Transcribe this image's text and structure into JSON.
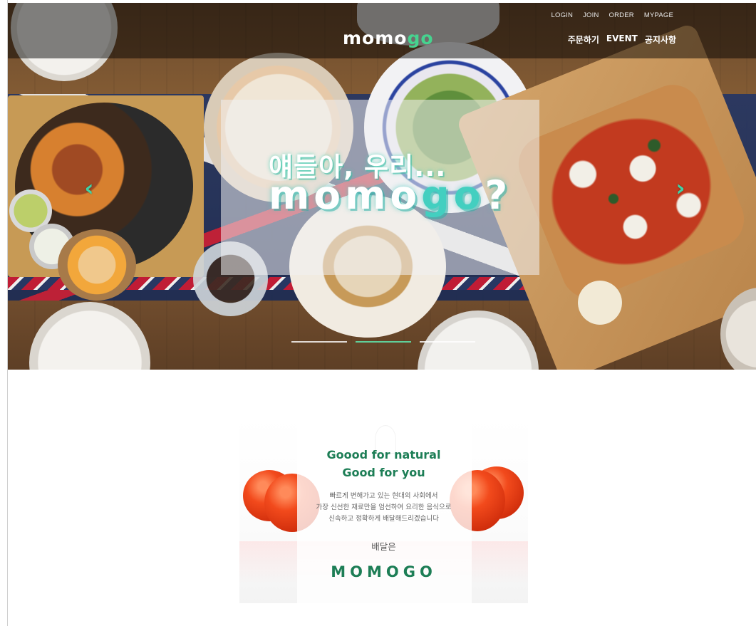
{
  "header": {
    "logo_part1": "momo",
    "logo_part2": "go",
    "top_links": [
      "LOGIN",
      "JOIN",
      "ORDER",
      "MYPAGE"
    ],
    "main_nav": [
      "주문하기",
      "EVENT",
      "공지사항"
    ]
  },
  "hero": {
    "headline_line1": "얘들아, 우리...",
    "headline_line2_part1": "momo",
    "headline_line2_part2": "go",
    "headline_line2_part3": "?",
    "prev_arrow": "‹",
    "next_arrow": "›",
    "slide_count": 3,
    "active_slide": 2
  },
  "promo": {
    "tagline_line1": "Goood for natural",
    "tagline_line2": "Good for you",
    "description": [
      "빠르게 변해가고 있는 현대의 사회에서",
      "가장 신선한 재료만을 엄선하여 요리한 음식으로",
      "신속하고 정확하게 배달해드리겠습니다"
    ],
    "delivery_label": "배달은",
    "brand_name": "MOMOGO"
  },
  "colors": {
    "accent_green": "#46d38f",
    "brand_dark_green": "#1d7e56",
    "hero_teal": "#43cfc0"
  }
}
